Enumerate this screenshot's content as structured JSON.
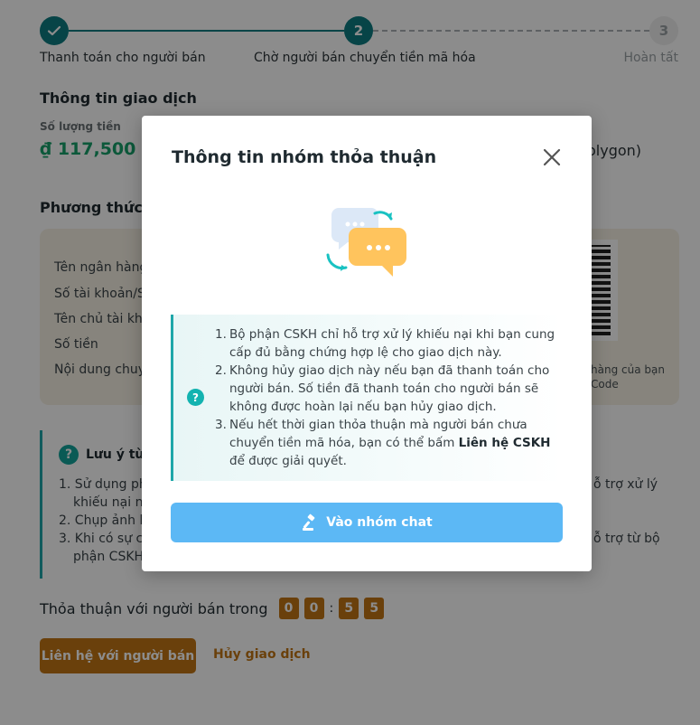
{
  "stepper": {
    "steps": [
      {
        "number": "",
        "label": "Thanh toán cho người bán"
      },
      {
        "number": "2",
        "label": "Chờ người bán chuyển tiền mã hóa"
      },
      {
        "number": "3",
        "label": "Hoàn tất"
      }
    ]
  },
  "transaction": {
    "section_title": "Thông tin giao dịch",
    "amount_label": "Số lượng tiền",
    "amount_value": "₫ 117,500",
    "network_value": "olygon)"
  },
  "payment": {
    "section_title": "Phương thức th",
    "rows": [
      "Tên ngân hàng",
      "Số tài khoản/S",
      "Tên chủ tài kho",
      "Số tiền",
      "Nội dung chuy"
    ],
    "qr_note_line1": "hàng của bạn",
    "qr_note_line2": "Code"
  },
  "notice": {
    "title": "Lưu ý từ h",
    "lines": [
      "1. Sử dụng phu",
      "khiếu nại nế",
      "2. Chụp ảnh hó",
      "3. Khi có sự cố",
      "phận CSKH."
    ],
    "right_lines": [
      "ỗ trợ xử lý",
      "ỗ trợ từ bộ"
    ]
  },
  "timer": {
    "label": "Thỏa thuận với người bán trong",
    "digits": [
      "0",
      "0",
      "5",
      "5"
    ],
    "separator": ":"
  },
  "actions": {
    "contact_label": "Liên hệ với người bán",
    "cancel_label": "Hủy giao dịch"
  },
  "modal": {
    "title": "Thông tin nhóm thỏa thuận",
    "info_icon": "question-icon",
    "items": [
      {
        "num": "1.",
        "text": "Bộ phận CSKH chỉ hỗ trợ xử lý khiếu nại khi bạn cung cấp đủ bằng chứng hợp lệ cho giao dịch này."
      },
      {
        "num": "2.",
        "text": "Không hủy giao dịch này nếu bạn đã thanh toán cho người bán. Số tiền đã thanh toán cho người bán sẽ không được hoàn lại nếu bạn hủy giao dịch."
      },
      {
        "num": "3.",
        "text_before": "Nếu hết thời gian thỏa thuận mà người bán chưa chuyển tiền mã hóa, bạn có thể bấm ",
        "text_bold": "Liên hệ CSKH",
        "text_after": " để được giải quyết."
      }
    ],
    "join_label": "Vào nhóm chat"
  },
  "colors": {
    "teal": "#0e7d82",
    "amount_green": "#17a06a",
    "orange": "#c27615",
    "join_blue": "#5cb8f5"
  }
}
